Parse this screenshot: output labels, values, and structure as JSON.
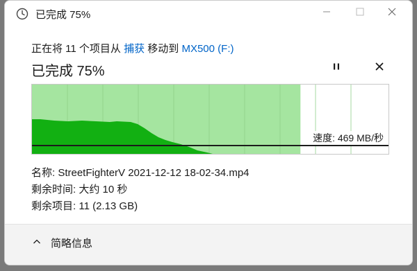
{
  "window": {
    "title": "已完成 75%"
  },
  "operation": {
    "prefix": "正在将 11 个项目从",
    "source": "捕获",
    "middle": "移动到",
    "destination": "MX500 (F:)"
  },
  "status": {
    "label": "已完成 75%",
    "progress_percent": 75
  },
  "speed": {
    "label": "速度: 469 MB/秒",
    "current_mb_per_s": 469
  },
  "details": {
    "name": "名称: StreetFighterV 2021-12-12 18-02-34.mp4",
    "time_left": "剩余时间: 大约 10 秒",
    "items_left": "剩余项目: 11 (2.13 GB)"
  },
  "footer": {
    "toggle_label": "简略信息"
  },
  "icons": {
    "app": "clock-icon",
    "minimize": "minimize-icon",
    "maximize": "maximize-icon",
    "close": "close-icon",
    "pause": "pause-icon",
    "cancel": "cancel-icon",
    "toggle": "chevron-up-icon"
  },
  "colors": {
    "link": "#0064c8",
    "progress_fill": "#a5e5a0",
    "speed_fill": "#12b012",
    "speed_line": "#1b1b1b"
  }
}
